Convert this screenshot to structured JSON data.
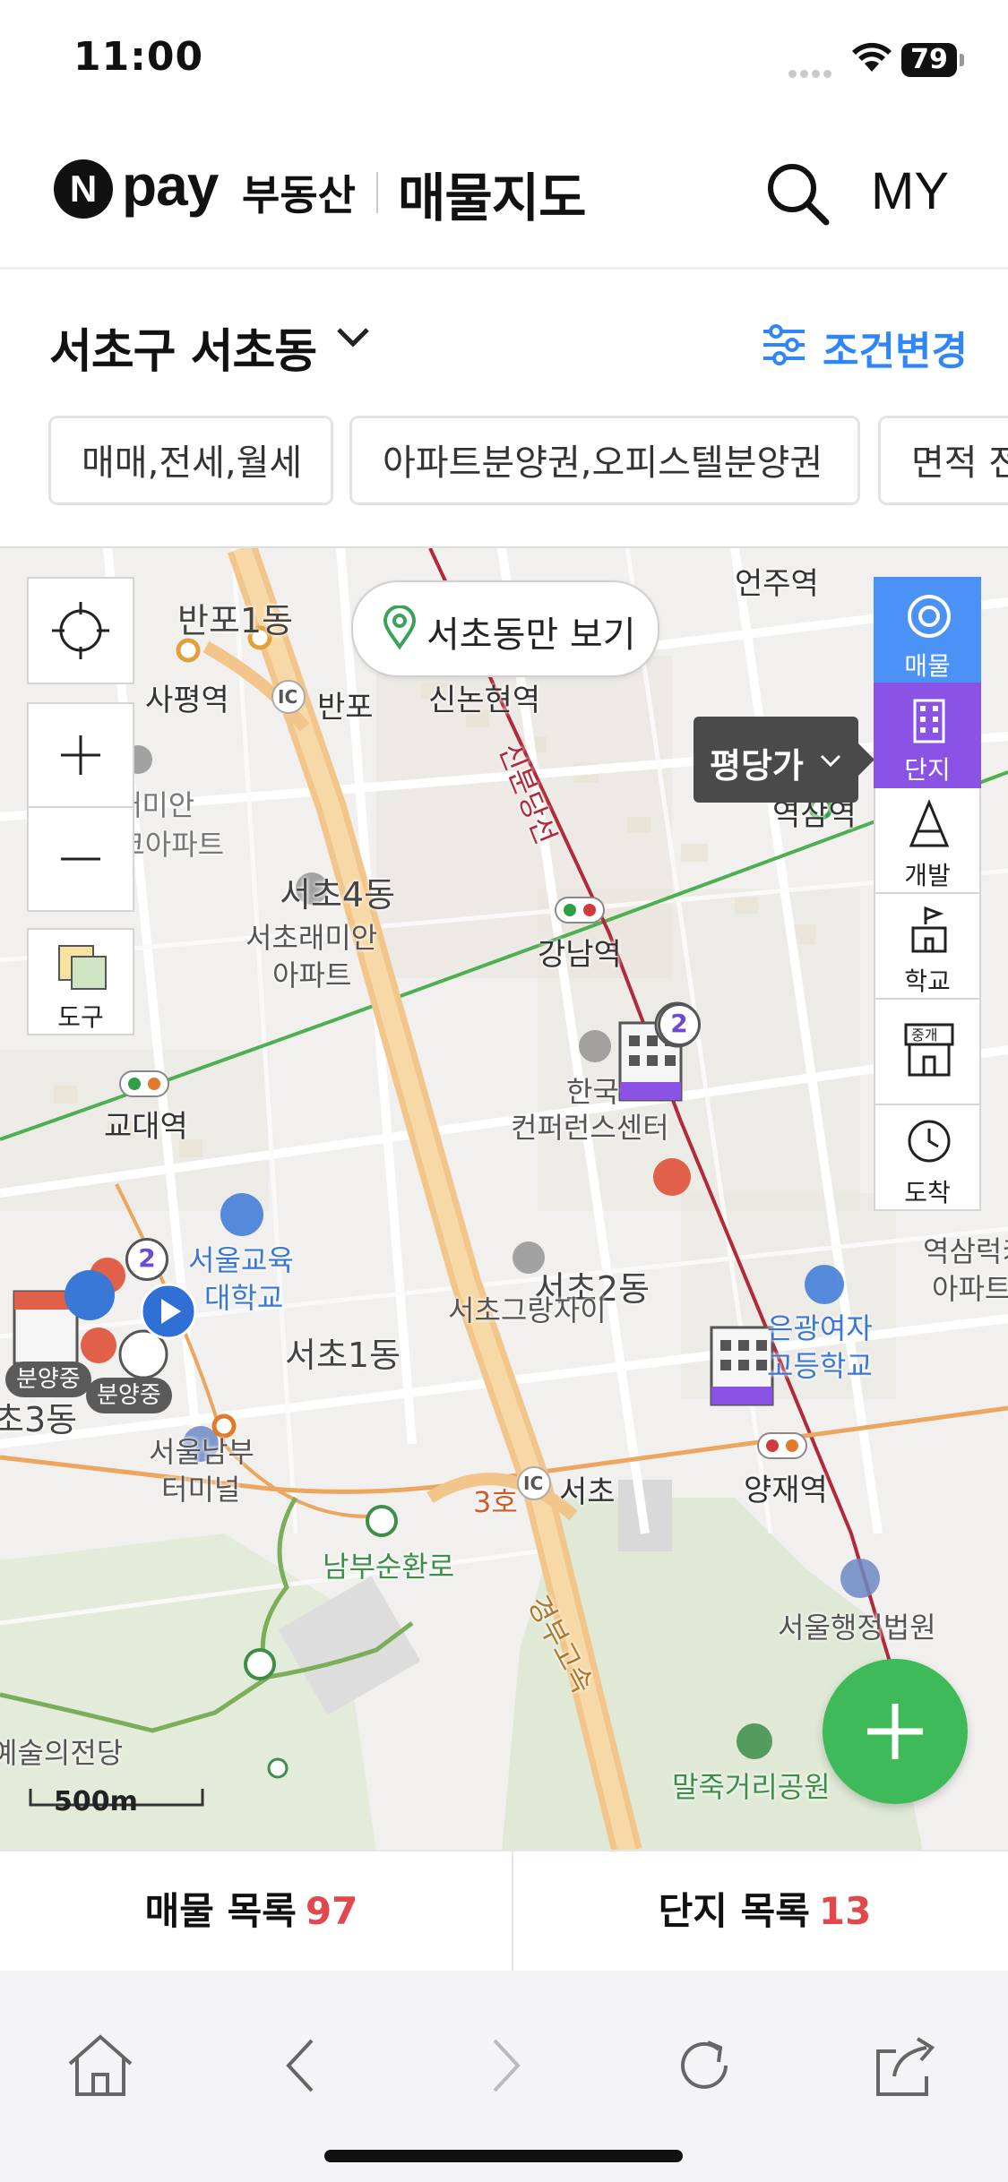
{
  "status_bar": {
    "time": "11:00",
    "battery": "79"
  },
  "header": {
    "logo_n": "N",
    "logo_pay": "pay",
    "logo_sub": "부동산",
    "title": "매물지도",
    "my_label": "MY"
  },
  "location": {
    "label": "서초구 서초동",
    "condition_change": "조건변경"
  },
  "chips": [
    "매매,전세,월세",
    "아파트분양권,오피스텔분양권",
    "면적 전"
  ],
  "map": {
    "only_button": "서초동만 보기",
    "tool_label": "도구",
    "tooltip": "평당가",
    "rail": [
      {
        "label": "매물",
        "icon": "target-icon"
      },
      {
        "label": "단지",
        "icon": "building-icon"
      },
      {
        "label": "개발",
        "icon": "development-icon"
      },
      {
        "label": "학교",
        "icon": "school-icon"
      },
      {
        "label": "중개",
        "icon": "agent-office-icon"
      },
      {
        "label": "도착",
        "icon": "clock-icon"
      }
    ],
    "scale": "500m",
    "labels": {
      "banpo1": "반포1동",
      "sapyeong": "사평역",
      "banpo_ic": "반포",
      "sinnonhyeon": "신논현역",
      "eonju": "언주역",
      "sinbundang": "신분당선",
      "raemian_top": "반포래미안",
      "raemian_top2": "아이파크아파트",
      "seocho4": "서초4동",
      "raemian_apt": "서초래미안",
      "raemian_apt2": "아파트",
      "gangnam": "강남역",
      "yeoksam": "역삼역",
      "yeoksam_partial": "역삼",
      "hanguk": "한국",
      "conference": "컨퍼런스센터",
      "gyodae": "교대역",
      "edu_univ": "서울교육",
      "edu_univ2": "대학교",
      "seocho2": "서초2동",
      "grandxi": "서초그랑자이",
      "seocho1": "서초1동",
      "eungwang": "은광여자",
      "eungwang2": "고등학교",
      "yeoksam_lucky": "역삼럭키",
      "yeoksam_lucky2": "아파트",
      "seocho3": "초3동",
      "nambu_terminal": "서울남부",
      "nambu_terminal2": "터미널",
      "nambu_ring": "남부순환로",
      "line3": "3호",
      "seocho_ic": "서초",
      "yangjae": "양재역",
      "gyeongbu": "경부고속",
      "admin_court": "서울행정법원",
      "arts_center": "예술의전당",
      "maljuk": "말죽거리공원",
      "sale_badge": "분양중",
      "count_2": "2"
    }
  },
  "bottom_tabs": [
    {
      "label": "매물 목록",
      "count": "97"
    },
    {
      "label": "단지 목록",
      "count": "13"
    }
  ],
  "colors": {
    "accent_blue": "#2f86f6",
    "count_red": "#e2474b",
    "rail_blue": "#4a92f5",
    "rail_purple": "#8a53e6",
    "fab_green": "#3ebb58",
    "road_orange": "#f2c58a"
  }
}
